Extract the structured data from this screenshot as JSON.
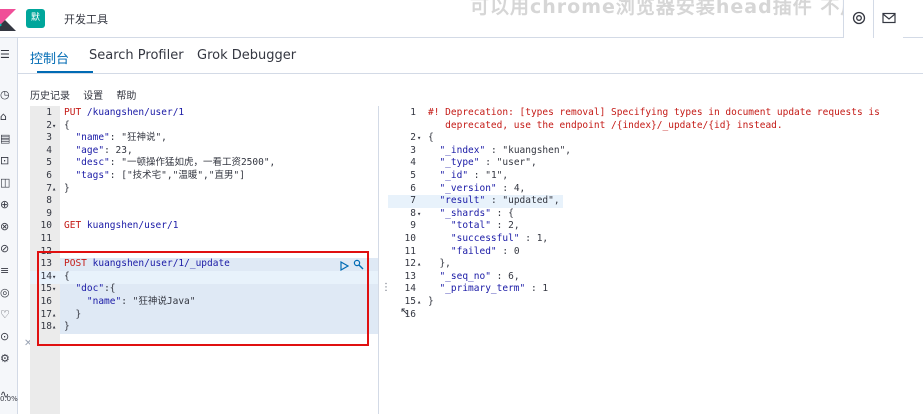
{
  "header": {
    "space_badge": "默",
    "app_title": "开发工具",
    "overlay_caption": "可以用chrome浏览器安装head插件 不用"
  },
  "tabs": [
    {
      "label": "控制台",
      "active": true
    },
    {
      "label": "Search Profiler",
      "active": false
    },
    {
      "label": "Grok Debugger",
      "active": false
    }
  ],
  "toolbar": {
    "history": "历史记录",
    "settings": "设置",
    "help": "帮助"
  },
  "leftnav": {
    "zoom_text": "0.0%"
  },
  "request_editor": {
    "line_numbers": [
      "1",
      "2",
      "3",
      "4",
      "5",
      "6",
      "7",
      "8",
      "9",
      "10",
      "11",
      "12",
      "13",
      "14",
      "15",
      "16",
      "17",
      "18"
    ],
    "lines": [
      "PUT /kuangshen/user/1",
      "{",
      "  \"name\": \"狂神说\",",
      "  \"age\": 23,",
      "  \"desc\": \"一顿操作猛如虎，一看工资2500\",",
      "  \"tags\": [\"技术宅\",\"温暖\",\"直男\"]",
      "}",
      "",
      "",
      "GET kuangshen/user/1",
      "",
      "",
      "POST kuangshen/user/1/_update",
      "{",
      "  \"doc\":{",
      "    \"name\": \"狂神说Java\"",
      "  }",
      "}"
    ]
  },
  "response_editor": {
    "line_numbers": [
      "1",
      "",
      "2",
      "3",
      "4",
      "5",
      "6",
      "7",
      "8",
      "9",
      "10",
      "11",
      "12",
      "13",
      "14",
      "15",
      "16"
    ],
    "lines": [
      "#! Deprecation: [types removal] Specifying types in document update requests is",
      "   deprecated, use the endpoint /{index}/_update/{id} instead.",
      "{",
      "  \"_index\" : \"kuangshen\",",
      "  \"_type\" : \"user\",",
      "  \"_id\" : \"1\",",
      "  \"_version\" : 4,",
      "  \"result\" : \"updated\",",
      "  \"_shards\" : {",
      "    \"total\" : 2,",
      "    \"successful\" : 1,",
      "    \"failed\" : 0",
      "  },",
      "  \"_seq_no\" : 6,",
      "  \"_primary_term\" : 1",
      "}",
      ""
    ]
  }
}
